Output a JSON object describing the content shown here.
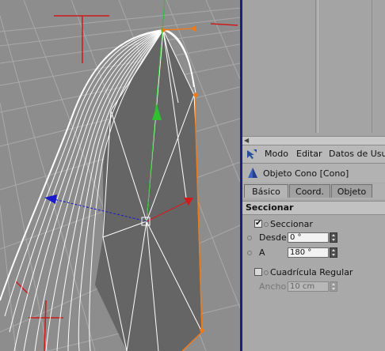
{
  "viewport": {
    "description_free": true
  },
  "attributes": {
    "menu": {
      "icon": "pointer-arrow-icon",
      "items": [
        "Modo",
        "Editar",
        "Datos de Usua"
      ]
    },
    "object_title": {
      "icon": "cone-icon",
      "label": "Objeto Cono [Cono]"
    },
    "tabs": [
      "Básico",
      "Coord.",
      "Objeto"
    ],
    "active_tab": "Básico",
    "section_title": "Seccionar",
    "seccionar_checkbox": {
      "label": "Seccionar",
      "checked": true
    },
    "desde": {
      "label": "Desde",
      "value": "0 °"
    },
    "a": {
      "label": "A",
      "value": "180 °"
    },
    "cuadricula_checkbox": {
      "label": "Cuadrícula Regular",
      "checked": false
    },
    "ancho": {
      "label": "Ancho",
      "value": "10 cm"
    }
  },
  "colors": {
    "selection_orange": "#f07a1a",
    "axis_y": "#2fbf2f",
    "axis_x": "#d41a1a",
    "axis_z": "#1a1acb",
    "splitter": "#1d1d85"
  }
}
